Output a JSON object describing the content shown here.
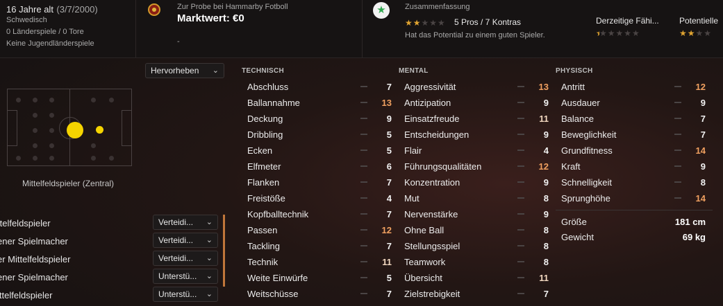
{
  "player": {
    "age": "16 Jahre alt",
    "birth": "(3/7/2000)",
    "nationality": "Schwedisch",
    "caps": "0 Länderspiele / 0 Tore",
    "youth": "Keine Jugendländerspiele"
  },
  "club": {
    "status": "Zur Probe bei Hammarby Fotboll",
    "value": "Marktwert: €0",
    "extra": "-"
  },
  "summary": {
    "title": "Zusammenfassung",
    "stars_filled": 2,
    "stars_total": 5,
    "pros_cons": "5 Pros / 7 Kontras",
    "description": "Hat das Potential zu einem guten Spieler.",
    "current_label": "Derzeitige Fähi...",
    "current_stars": 0.5,
    "potential_label": "Potentielle",
    "potential_stars": 2
  },
  "highlight_dropdown": "Hervorheben",
  "position_label": "Mittelfeldspieler (Zentral)",
  "roles": [
    {
      "name": "ttelfeldspieler",
      "duty": "Verteidi..."
    },
    {
      "name": "ener Spielmacher",
      "duty": "Verteidi..."
    },
    {
      "name": "er Mittelfeldspieler",
      "duty": "Verteidi..."
    },
    {
      "name": "ener Spielmacher",
      "duty": "Unterstü..."
    },
    {
      "name": "ittelfeldspieler",
      "duty": "Unterstü..."
    }
  ],
  "technical": {
    "title": "TECHNISCH",
    "attrs": [
      {
        "name": "Abschluss",
        "value": "7"
      },
      {
        "name": "Ballannahme",
        "value": "13"
      },
      {
        "name": "Deckung",
        "value": "9"
      },
      {
        "name": "Dribbling",
        "value": "5"
      },
      {
        "name": "Ecken",
        "value": "5"
      },
      {
        "name": "Elfmeter",
        "value": "6"
      },
      {
        "name": "Flanken",
        "value": "7"
      },
      {
        "name": "Freistöße",
        "value": "4"
      },
      {
        "name": "Kopfballtechnik",
        "value": "7"
      },
      {
        "name": "Passen",
        "value": "12"
      },
      {
        "name": "Tackling",
        "value": "7"
      },
      {
        "name": "Technik",
        "value": "11"
      },
      {
        "name": "Weite Einwürfe",
        "value": "5"
      },
      {
        "name": "Weitschüsse",
        "value": "7"
      }
    ]
  },
  "mental": {
    "title": "MENTAL",
    "attrs": [
      {
        "name": "Aggressivität",
        "value": "13"
      },
      {
        "name": "Antizipation",
        "value": "9"
      },
      {
        "name": "Einsatzfreude",
        "value": "11"
      },
      {
        "name": "Entscheidungen",
        "value": "9"
      },
      {
        "name": "Flair",
        "value": "4"
      },
      {
        "name": "Führungsqualitäten",
        "value": "12"
      },
      {
        "name": "Konzentration",
        "value": "9"
      },
      {
        "name": "Mut",
        "value": "8"
      },
      {
        "name": "Nervenstärke",
        "value": "9"
      },
      {
        "name": "Ohne Ball",
        "value": "8"
      },
      {
        "name": "Stellungsspiel",
        "value": "8"
      },
      {
        "name": "Teamwork",
        "value": "8"
      },
      {
        "name": "Übersicht",
        "value": "11"
      },
      {
        "name": "Zielstrebigkeit",
        "value": "7"
      }
    ]
  },
  "physical": {
    "title": "PHYSISCH",
    "attrs": [
      {
        "name": "Antritt",
        "value": "12"
      },
      {
        "name": "Ausdauer",
        "value": "9"
      },
      {
        "name": "Balance",
        "value": "7"
      },
      {
        "name": "Beweglichkeit",
        "value": "7"
      },
      {
        "name": "Grundfitness",
        "value": "14"
      },
      {
        "name": "Kraft",
        "value": "9"
      },
      {
        "name": "Schnelligkeit",
        "value": "8"
      },
      {
        "name": "Sprunghöhe",
        "value": "14"
      }
    ],
    "height_label": "Größe",
    "height_value": "181 cm",
    "weight_label": "Gewicht",
    "weight_value": "69 kg"
  },
  "colors": {
    "accent_orange": "#f0a060",
    "star_gold": "#e0a431",
    "position_yellow": "#f5d400"
  }
}
